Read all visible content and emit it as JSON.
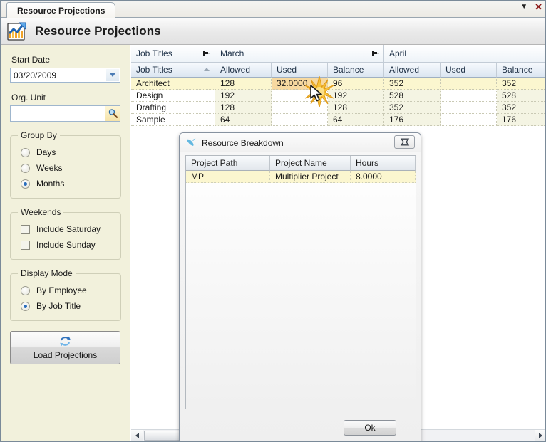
{
  "window": {
    "tab_label": "Resource Projections",
    "dropdown_icon": "chevron-down-icon",
    "close_icon": "close-x-icon"
  },
  "header": {
    "title": "Resource Projections",
    "icon": "chart-report-icon"
  },
  "sidebar": {
    "start_date": {
      "label": "Start Date",
      "value": "03/20/2009"
    },
    "org_unit": {
      "label": "Org. Unit",
      "value": "",
      "placeholder": "",
      "search_icon": "magnifier-icon"
    },
    "group_by": {
      "legend": "Group By",
      "options": [
        {
          "label": "Days",
          "selected": false
        },
        {
          "label": "Weeks",
          "selected": false
        },
        {
          "label": "Months",
          "selected": true
        }
      ]
    },
    "weekends": {
      "legend": "Weekends",
      "options": [
        {
          "label": "Include Saturday",
          "checked": false
        },
        {
          "label": "Include Sunday",
          "checked": false
        }
      ]
    },
    "display_mode": {
      "legend": "Display Mode",
      "options": [
        {
          "label": "By Employee",
          "selected": false
        },
        {
          "label": "By Job Title",
          "selected": true
        }
      ]
    },
    "load_button": {
      "label": "Load Projections",
      "icon": "refresh-icon"
    }
  },
  "grid": {
    "bands": [
      {
        "label": "Job Titles",
        "pin_icon": "pin-icon",
        "has_pin": true
      },
      {
        "label": "March",
        "pin_icon": "pin-icon",
        "has_pin": true
      },
      {
        "label": "April",
        "pin_icon": "pin-icon",
        "has_pin": false
      }
    ],
    "columns": [
      {
        "label": "Job Titles",
        "sort": "asc"
      },
      {
        "label": "Allowed",
        "sort": ""
      },
      {
        "label": "Used",
        "sort": ""
      },
      {
        "label": "Balance",
        "sort": ""
      },
      {
        "label": "Allowed",
        "sort": ""
      },
      {
        "label": "Used",
        "sort": ""
      },
      {
        "label": "Balance",
        "sort": ""
      }
    ],
    "rows": [
      {
        "selected": true,
        "cells": [
          "Architect",
          "128",
          "32.0000",
          "96",
          "352",
          "",
          "352"
        ],
        "hot_cell": 2
      },
      {
        "selected": false,
        "cells": [
          "Design",
          "192",
          "",
          "192",
          "528",
          "",
          "528"
        ],
        "hot_cell": -1
      },
      {
        "selected": false,
        "cells": [
          "Drafting",
          "128",
          "",
          "128",
          "352",
          "",
          "352"
        ],
        "hot_cell": -1
      },
      {
        "selected": false,
        "cells": [
          "Sample",
          "64",
          "",
          "64",
          "176",
          "",
          "176"
        ],
        "hot_cell": -1
      }
    ],
    "scrollbar": {
      "left_icon": "arrow-left-icon",
      "right_icon": "arrow-right-icon"
    }
  },
  "dialog": {
    "title": "Resource Breakdown",
    "icon": "bird-icon",
    "close_label": "✖",
    "columns": [
      "Project Path",
      "Project Name",
      "Hours"
    ],
    "rows": [
      {
        "cells": [
          "MP",
          "Multiplier Project",
          "8.0000"
        ]
      }
    ],
    "ok_label": "Ok"
  },
  "cursor": {
    "icon": "mouse-pointer-icon",
    "effect": "click-sparkle"
  },
  "colors": {
    "sidebar_bg": "#f2f1dc",
    "row_selected": "#fbf6cf",
    "cell_hot": "#f7d9a0",
    "header_blue": "#dbe6f1",
    "accent_close": "#8b1616"
  }
}
